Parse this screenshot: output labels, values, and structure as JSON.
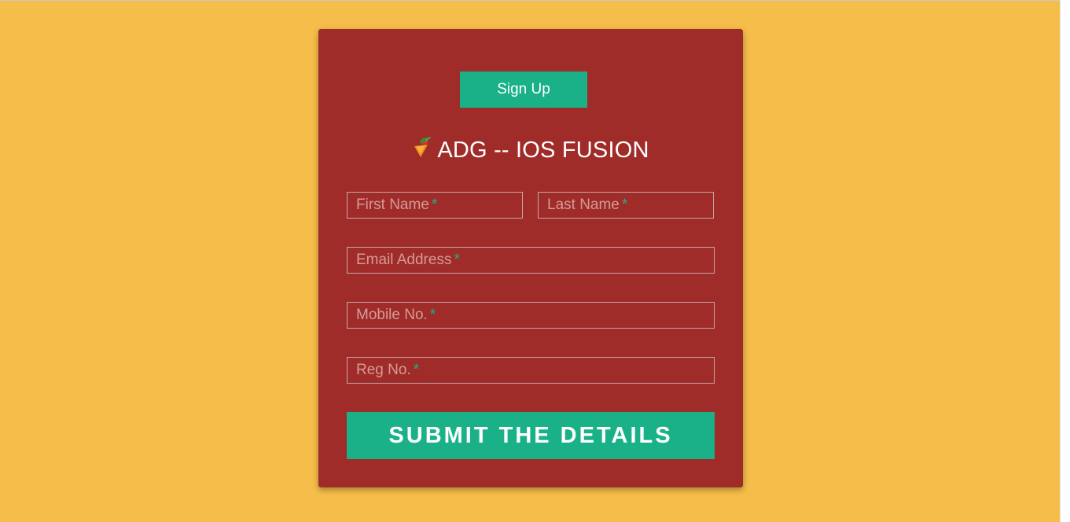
{
  "tab": {
    "signup_label": "Sign Up"
  },
  "brand": {
    "title": "ADG -- IOS FUSION",
    "logo_icon": "adg-logo-icon"
  },
  "form": {
    "first_name": {
      "placeholder": "First Name",
      "required_mark": "*",
      "value": ""
    },
    "last_name": {
      "placeholder": "Last Name",
      "required_mark": "*",
      "value": ""
    },
    "email": {
      "placeholder": "Email Address",
      "required_mark": "*",
      "value": ""
    },
    "mobile": {
      "placeholder": "Mobile No.",
      "required_mark": "*",
      "value": ""
    },
    "reg_no": {
      "placeholder": "Reg No.",
      "required_mark": "*",
      "value": ""
    },
    "submit_label": "SUBMIT THE DETAILS"
  },
  "colors": {
    "background": "#f5be4a",
    "card": "#a02c2a",
    "accent": "#1ab188",
    "placeholder": "#d59a97"
  }
}
